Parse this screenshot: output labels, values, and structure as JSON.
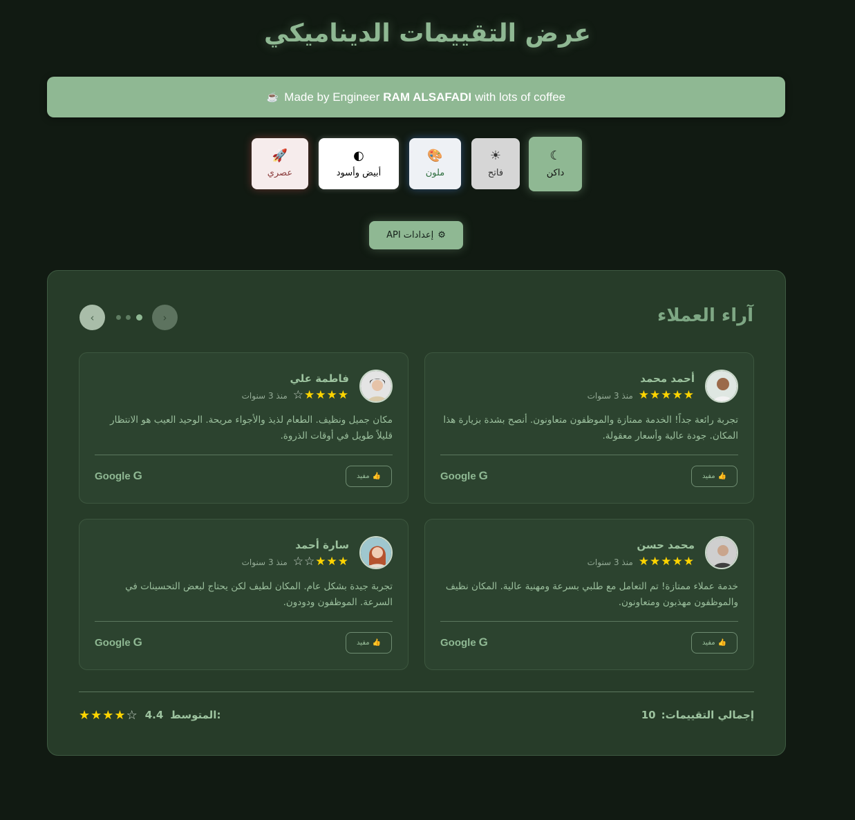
{
  "header": {
    "title": "عرض التقييمات الديناميكي",
    "credit_prefix": "Made by Engineer",
    "credit_name": "RAM ALSAFADI",
    "credit_suffix": "with lots of coffee"
  },
  "themes": [
    {
      "label": "عصري",
      "icon": "rocket-icon"
    },
    {
      "label": "أبيض وأسود",
      "icon": "contrast-icon"
    },
    {
      "label": "ملون",
      "icon": "palette-icon"
    },
    {
      "label": "فاتح",
      "icon": "sun-icon"
    },
    {
      "label": "داكن",
      "icon": "moon-icon",
      "active": true
    }
  ],
  "api_button": {
    "label": "إعدادات API",
    "icon": "gear-icon"
  },
  "reviews_panel": {
    "title": "آراء العملاء",
    "carousel_pages": 3,
    "active_page": 3
  },
  "reviews": [
    {
      "name": "أحمد محمد",
      "rating": 5,
      "time": "منذ 3 سنوات",
      "text": "تجربة رائعة جداً! الخدمة ممتازة والموظفون متعاونون. أنصح بشدة بزيارة هذا المكان. جودة عالية وأسعار معقولة.",
      "helpful": "مفيد",
      "source": "Google"
    },
    {
      "name": "فاطمة علي",
      "rating": 4,
      "time": "منذ 3 سنوات",
      "text": "مكان جميل ونظيف. الطعام لذيذ والأجواء مريحة. الوحيد العيب هو الانتظار قليلاً طويل في أوقات الذروة.",
      "helpful": "مفيد",
      "source": "Google"
    },
    {
      "name": "محمد حسن",
      "rating": 5,
      "time": "منذ 3 سنوات",
      "text": "خدمة عملاء ممتازة! تم التعامل مع طلبي بسرعة ومهنية عالية. المكان نظيف والموظفون مهذبون ومتعاونون.",
      "helpful": "مفيد",
      "source": "Google"
    },
    {
      "name": "سارة أحمد",
      "rating": 3,
      "time": "منذ 3 سنوات",
      "text": "تجربة جيدة بشكل عام. المكان لطيف لكن يحتاج لبعض التحسينات في السرعة. الموظفون ودودون.",
      "helpful": "مفيد",
      "source": "Google"
    }
  ],
  "summary": {
    "total_label": "إجمالي التقييمات:",
    "total_value": "10",
    "avg_label": "المتوسط:",
    "avg_value": "4.4",
    "avg_stars": 4
  },
  "colors": {
    "background": "#111a12",
    "accent": "#8fb893",
    "panel": "#273c29",
    "star": "#ffd400"
  }
}
